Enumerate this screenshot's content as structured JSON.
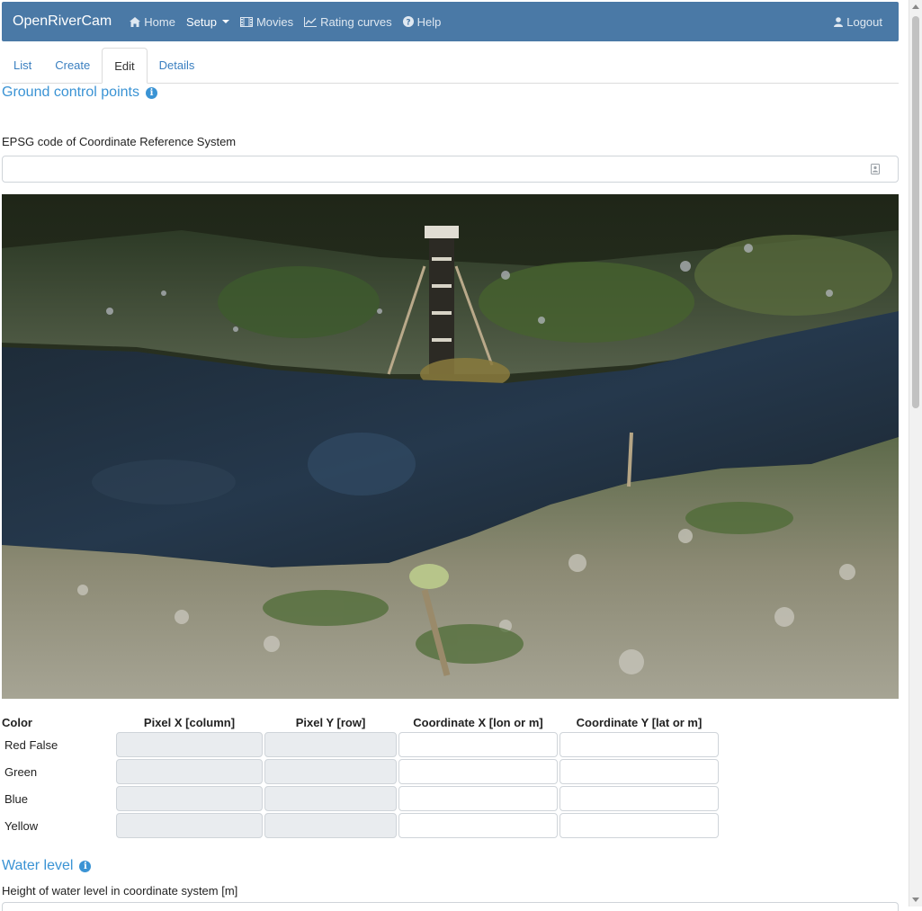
{
  "navbar": {
    "brand": "OpenRiverCam",
    "items": [
      {
        "label": "Home",
        "icon": "home-icon"
      },
      {
        "label": "Setup",
        "icon": "",
        "active": true
      },
      {
        "label": "Movies",
        "icon": "film-icon"
      },
      {
        "label": "Rating curves",
        "icon": "line-chart-icon"
      },
      {
        "label": "Help",
        "icon": "question-circle-icon"
      }
    ],
    "logout": {
      "label": "Logout",
      "icon": "user-icon"
    }
  },
  "tabs": [
    "List",
    "Create",
    "Edit",
    "Details"
  ],
  "active_tab": "Edit",
  "gcp_section": {
    "title": "Ground control points",
    "epsg_label": "EPSG code of Coordinate Reference System",
    "epsg_value": "",
    "image_alt": "Camera image of river stream with ground control points"
  },
  "gcp_table": {
    "headers": [
      "Color",
      "Pixel X [column]",
      "Pixel Y [row]",
      "Coordinate X [lon or m]",
      "Coordinate Y [lat or m]"
    ],
    "rows": [
      {
        "color": "Red False",
        "px": "",
        "py": "",
        "cx": "",
        "cy": ""
      },
      {
        "color": "Green",
        "px": "",
        "py": "",
        "cx": "",
        "cy": ""
      },
      {
        "color": "Blue",
        "px": "",
        "py": "",
        "cx": "",
        "cy": ""
      },
      {
        "color": "Yellow",
        "px": "",
        "py": "",
        "cx": "",
        "cy": ""
      }
    ]
  },
  "water_level": {
    "title": "Water level",
    "label": "Height of water level in coordinate system [m]"
  },
  "colors": {
    "navbar": "#4a79a6",
    "link": "#3a7fc0",
    "section_title": "#3a93d4"
  }
}
